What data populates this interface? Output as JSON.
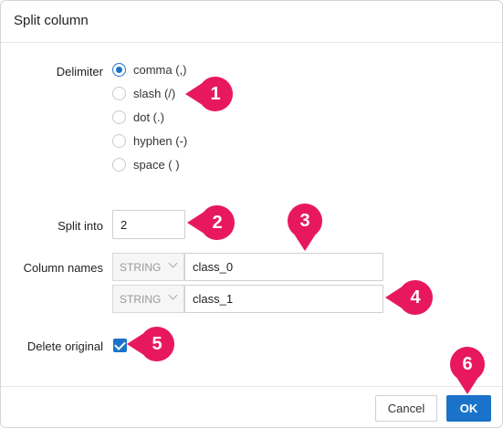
{
  "dialog": {
    "title": "Split column"
  },
  "delimiter": {
    "label": "Delimiter",
    "options": [
      {
        "label": "comma (,)",
        "checked": true
      },
      {
        "label": "slash (/)",
        "checked": false
      },
      {
        "label": "dot (.)",
        "checked": false
      },
      {
        "label": "hyphen (-)",
        "checked": false
      },
      {
        "label": "space ( )",
        "checked": false
      }
    ]
  },
  "split_into": {
    "label": "Split into",
    "value": "2"
  },
  "column_names": {
    "label": "Column names",
    "rows": [
      {
        "type": "STRING",
        "name": "class_0"
      },
      {
        "type": "STRING",
        "name": "class_1"
      }
    ]
  },
  "delete_original": {
    "label": "Delete original",
    "checked": true
  },
  "buttons": {
    "cancel": "Cancel",
    "ok": "OK"
  },
  "callouts": [
    "1",
    "2",
    "3",
    "4",
    "5",
    "6"
  ],
  "colors": {
    "accent": "#1a73c8",
    "callout": "#e8185f"
  },
  "icons": [
    "radio-selected-icon",
    "radio-unselected-icon",
    "chevron-down-icon",
    "checkbox-checked-icon"
  ]
}
